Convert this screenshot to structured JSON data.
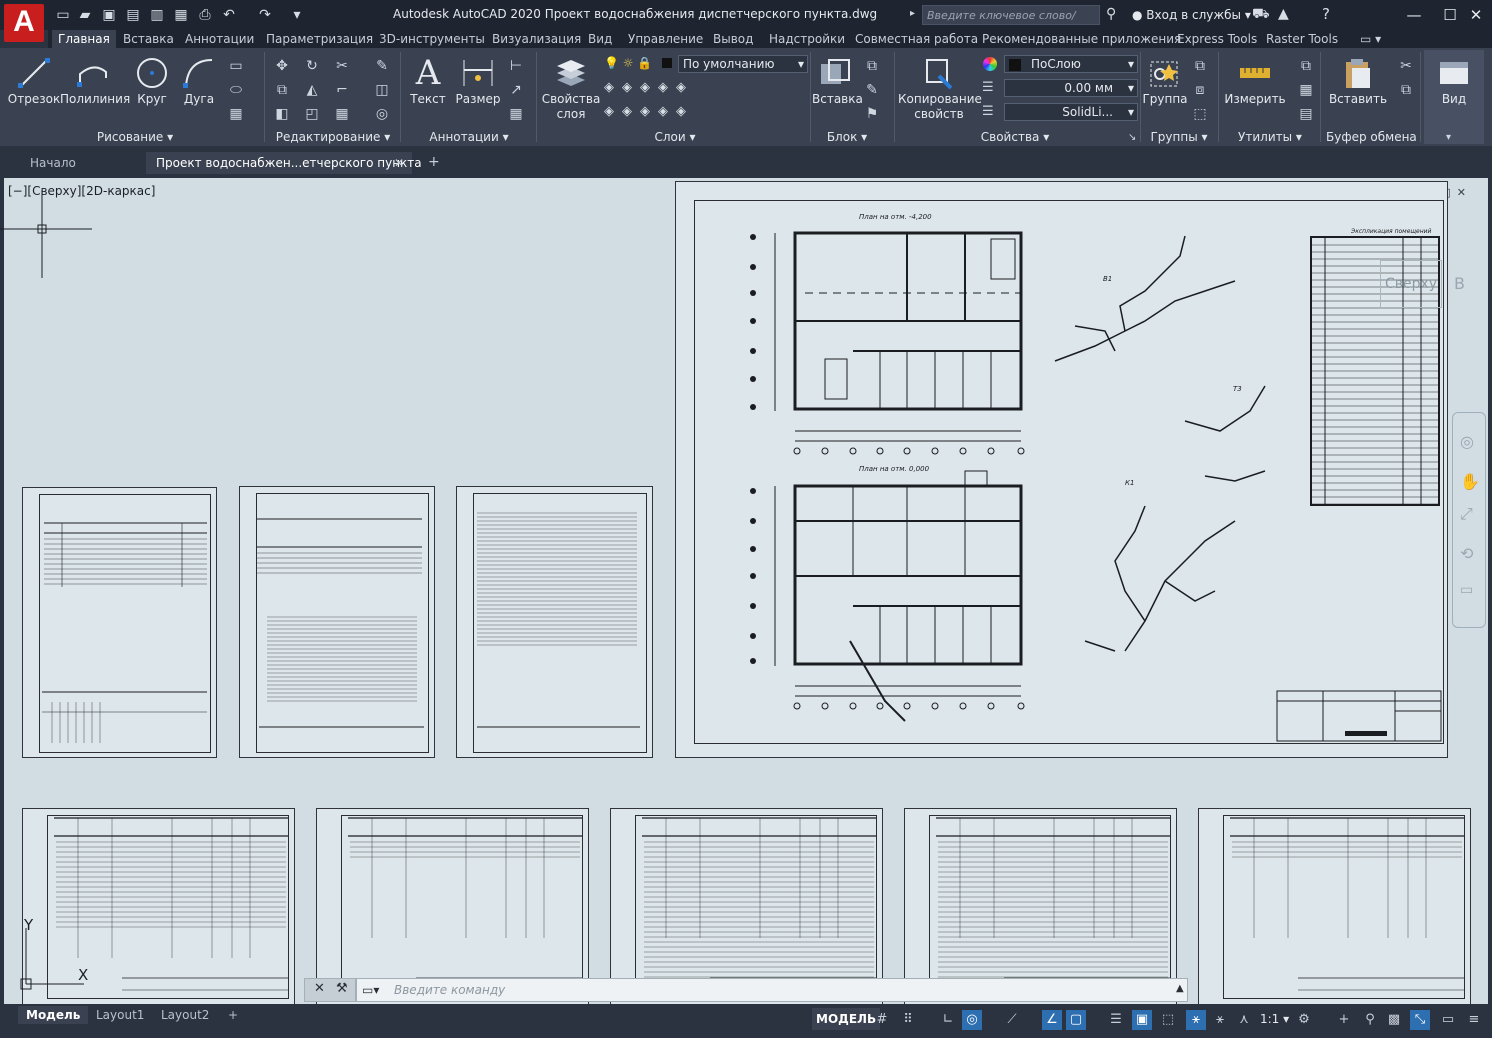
{
  "app": {
    "logo": "A",
    "title": "Autodesk AutoCAD 2020   Проект водоснабжения диспетчерского пункта.dwg",
    "search_placeholder": "Введите ключевое слово/фразу",
    "sign_in": "Вход в службы"
  },
  "ribbon_tabs": [
    "Главная",
    "Вставка",
    "Аннотации",
    "Параметризация",
    "3D-инструменты",
    "Визуализация",
    "Вид",
    "Управление",
    "Вывод",
    "Надстройки",
    "Совместная работа",
    "Рекомендованные приложения",
    "Express Tools",
    "Raster Tools"
  ],
  "ribbon": {
    "draw": {
      "title": "Рисование",
      "line": "Отрезок",
      "polyline": "Полилиния",
      "circle": "Круг",
      "arc": "Дуга"
    },
    "modify": {
      "title": "Редактирование"
    },
    "annotation": {
      "title": "Аннотации",
      "text": "Текст",
      "dimension": "Размер"
    },
    "layers": {
      "title": "Слои",
      "layer_props_1": "Свойства",
      "layer_props_2": "слоя",
      "current_layer": "По умолчанию"
    },
    "block": {
      "title": "Блок",
      "insert": "Вставка"
    },
    "properties": {
      "title": "Свойства",
      "match_1": "Копирование",
      "match_2": "свойств",
      "color": "ПоСлою",
      "lineweight": "0.00 мм",
      "linetype": "SolidLi..."
    },
    "groups": {
      "title": "Группы",
      "group": "Группа"
    },
    "utilities": {
      "title": "Утилиты",
      "measure": "Измерить"
    },
    "clipboard": {
      "title": "Буфер обмена",
      "paste": "Вставить"
    },
    "view": {
      "title": "Вид"
    }
  },
  "doc_tabs": {
    "start": "Начало",
    "file": "Проект водоснабжен...етчерского пункта"
  },
  "viewport": {
    "label": "[−][Сверху][2D-каркас]",
    "viewcube": "Сверху",
    "viewcube_side": "В"
  },
  "ucs": {
    "x": "X",
    "y": "Y"
  },
  "command": {
    "placeholder": "Введите команду"
  },
  "layout_tabs": [
    "Модель",
    "Layout1",
    "Layout2"
  ],
  "status": {
    "mode": "МОДЕЛЬ",
    "scale": "1:1"
  },
  "drawing": {
    "plan1_title": "План на отм. -4,200",
    "plan2_title": "План на отм. 0,000",
    "iso_b1": "В1",
    "iso_t3": "Т3",
    "iso_k1": "К1",
    "spec_title": "Экспликация помещений"
  }
}
